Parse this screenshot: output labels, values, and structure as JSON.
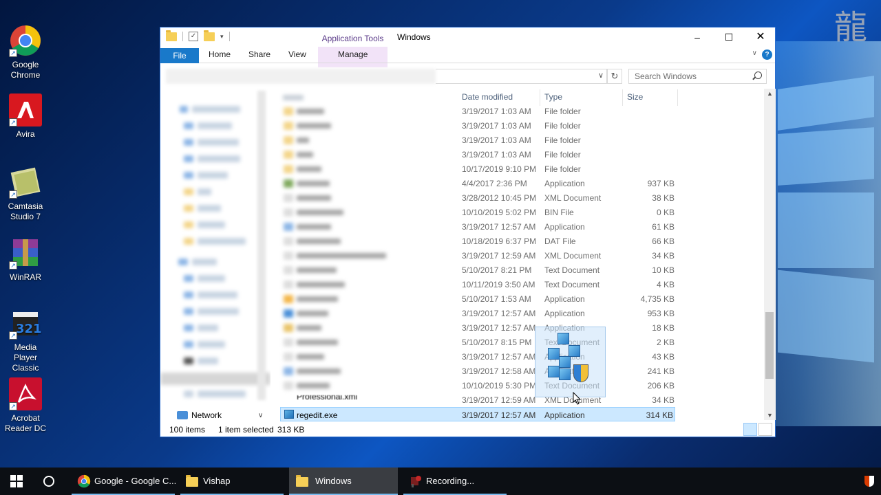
{
  "desktop": {
    "icons": [
      {
        "label": "Google Chrome",
        "icon": "chrome-icon"
      },
      {
        "label": "Avira",
        "icon": "avira-icon"
      },
      {
        "label": "Camtasia Studio 7",
        "icon": "camtasia-icon"
      },
      {
        "label": "WinRAR",
        "icon": "winrar-icon"
      },
      {
        "label": "Media Player Classic",
        "icon": "media-player-classic-icon"
      },
      {
        "label": "Acrobat Reader DC",
        "icon": "acrobat-icon"
      }
    ]
  },
  "window": {
    "title": "Windows",
    "context_tab_title": "Application Tools",
    "ribbon_tabs": [
      "File",
      "Home",
      "Share",
      "View",
      "Manage"
    ],
    "search_placeholder": "Search Windows",
    "columns": {
      "date": "Date modified",
      "type": "Type",
      "size": "Size"
    },
    "rows": [
      {
        "date": "3/19/2017 1:03 AM",
        "type": "File folder",
        "size": ""
      },
      {
        "date": "3/19/2017 1:03 AM",
        "type": "File folder",
        "size": ""
      },
      {
        "date": "3/19/2017 1:03 AM",
        "type": "File folder",
        "size": ""
      },
      {
        "date": "3/19/2017 1:03 AM",
        "type": "File folder",
        "size": ""
      },
      {
        "date": "10/17/2019 9:10 PM",
        "type": "File folder",
        "size": ""
      },
      {
        "date": "4/4/2017 2:36 PM",
        "type": "Application",
        "size": "937 KB"
      },
      {
        "date": "3/28/2012 10:45 PM",
        "type": "XML Document",
        "size": "38 KB"
      },
      {
        "date": "10/10/2019 5:02 PM",
        "type": "BIN File",
        "size": "0 KB"
      },
      {
        "date": "3/19/2017 12:57 AM",
        "type": "Application",
        "size": "61 KB"
      },
      {
        "date": "10/18/2019 6:37 PM",
        "type": "DAT File",
        "size": "66 KB"
      },
      {
        "date": "3/19/2017 12:59 AM",
        "type": "XML Document",
        "size": "34 KB"
      },
      {
        "date": "5/10/2017 8:21 PM",
        "type": "Text Document",
        "size": "10 KB"
      },
      {
        "date": "10/11/2019 3:50 AM",
        "type": "Text Document",
        "size": "4 KB"
      },
      {
        "date": "5/10/2017 1:53 AM",
        "type": "Application",
        "size": "4,735 KB"
      },
      {
        "date": "3/19/2017 12:57 AM",
        "type": "Application",
        "size": "953 KB"
      },
      {
        "date": "3/19/2017 12:57 AM",
        "type": "Application",
        "size": "18 KB"
      },
      {
        "date": "5/10/2017 8:15 PM",
        "type": "Text Document",
        "size": "2 KB"
      },
      {
        "date": "3/19/2017 12:57 AM",
        "type": "Application",
        "size": "43 KB"
      },
      {
        "date": "3/19/2017 12:58 AM",
        "type": "Application",
        "size": "241 KB"
      },
      {
        "date": "10/10/2019 5:30 PM",
        "type": "Text Document",
        "size": "206 KB"
      },
      {
        "date": "3/19/2017 12:59 AM",
        "type": "XML Document",
        "size": "34 KB"
      }
    ],
    "partial_name": "Professional.xml",
    "selected": {
      "name": "regedit.exe",
      "date": "3/19/2017 12:57 AM",
      "type": "Application",
      "size": "314 KB"
    },
    "nav_network": "Network",
    "status": {
      "count": "100 items",
      "selection": "1 item selected",
      "size": "313 KB"
    }
  },
  "taskbar": {
    "items": [
      {
        "label": "Google - Google C...",
        "icon": "chrome-icon"
      },
      {
        "label": "Vishap",
        "icon": "folder-icon"
      },
      {
        "label": "Windows",
        "icon": "folder-icon"
      },
      {
        "label": "Recording...",
        "icon": "camtasia-recorder-icon"
      }
    ]
  },
  "colors": {
    "accent": "#1979ca",
    "selection": "#cce8ff",
    "context_tab": "#f2e3f8"
  }
}
